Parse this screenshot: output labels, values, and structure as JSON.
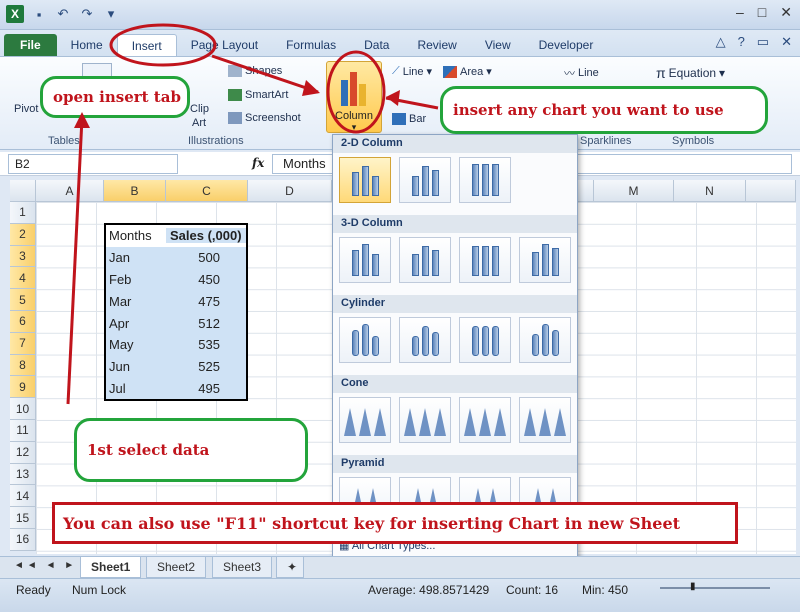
{
  "titlebar": {
    "qat_icons": [
      "excel-logo",
      "save-icon",
      "undo-icon",
      "redo-icon"
    ],
    "window_buttons": [
      "–",
      "□",
      "✕"
    ]
  },
  "tabs": [
    {
      "label": "File"
    },
    {
      "label": "Home"
    },
    {
      "label": "Insert"
    },
    {
      "label": "Page Layout"
    },
    {
      "label": "Formulas"
    },
    {
      "label": "Data"
    },
    {
      "label": "Review"
    },
    {
      "label": "View"
    },
    {
      "label": "Developer"
    }
  ],
  "ribbon": {
    "pivot_label": "Pivot",
    "shapes_label": "Shapes",
    "smartart_label": "SmartArt",
    "screenshot_label": "Screenshot",
    "clip_label": "Clip",
    "art_label": "Art",
    "illustrations_label": "Illustrations",
    "column_label": "Column",
    "line_label": "Line",
    "area_label": "Area",
    "bar_label": "Bar",
    "sparkline_line_label": "Line",
    "equation_label": "Equation",
    "tables_label": "Tables",
    "sparklines_label": "Sparklines",
    "symbols_label": "Symbols"
  },
  "formula_bar": {
    "name_box": "B2",
    "fx": "fx",
    "value": "Months"
  },
  "columns": [
    "A",
    "B",
    "C",
    "D",
    "M",
    "N"
  ],
  "rows": [
    "1",
    "2",
    "3",
    "4",
    "5",
    "6",
    "7",
    "8",
    "9",
    "10",
    "11",
    "12",
    "13",
    "14",
    "15",
    "16"
  ],
  "table": {
    "header": [
      "Months",
      "Sales (,000)"
    ],
    "rows": [
      [
        "Jan",
        "500"
      ],
      [
        "Feb",
        "450"
      ],
      [
        "Mar",
        "475"
      ],
      [
        "Apr",
        "512"
      ],
      [
        "May",
        "535"
      ],
      [
        "Jun",
        "525"
      ],
      [
        "Jul",
        "495"
      ]
    ]
  },
  "dropdown": {
    "sections": [
      "2-D Column",
      "3-D Column",
      "Cylinder",
      "Cone",
      "Pyramid"
    ],
    "footer": "All Chart Types..."
  },
  "sheets": [
    "Sheet1",
    "Sheet2",
    "Sheet3"
  ],
  "status": {
    "ready": "Ready",
    "numlock": "Num Lock",
    "average": "Average: 498.8571429",
    "count": "Count: 16",
    "min": "Min: 450"
  },
  "annotations": {
    "open_insert": "open insert tab",
    "insert_chart": "insert any chart you want to use",
    "select_data": "1st select data",
    "f11_tip": "You can also use \"F11\" shortcut key for inserting Chart in new Sheet"
  },
  "colors": {
    "annotation_red": "#c0141c",
    "annotation_green": "#23a43b",
    "file_tab": "#2c7a3f",
    "selection": "#cfe2f5"
  }
}
